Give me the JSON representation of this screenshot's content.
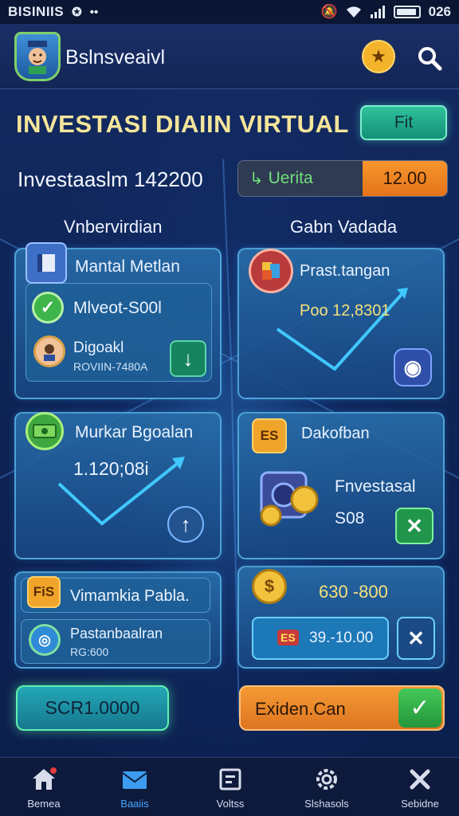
{
  "status_bar": {
    "carrier": "BISINIIS",
    "time": "026"
  },
  "header": {
    "app_title": "Bslnsveaivl"
  },
  "headline": "INVESTASI DIAIIN VIRTUAL",
  "fit_button": "Fit",
  "investment": {
    "label": "Investaaslm 142200",
    "pill_left": "Uerita",
    "pill_right": "12.00"
  },
  "columns": {
    "left": "Vnbervirdian",
    "right": "Gabn Vadada"
  },
  "cards": {
    "mantal": {
      "title": "Mantal Metlan",
      "row1": "Mlveot-S00l",
      "row2_title": "Digoakl",
      "row2_sub": "ROVIIN-7480A"
    },
    "prast": {
      "title": "Prast.tangan",
      "value": "Poo 12,8301"
    },
    "murkar": {
      "title": "Murkar Bgoalan",
      "value": "1.120;08i"
    },
    "dakof": {
      "title": "Dakofban",
      "badge": "ES",
      "line1": "Fnvestasal",
      "line2": "S08"
    },
    "vimamkia": {
      "badge": "FiS",
      "title": "Vimamkia Pabla.",
      "sub_title": "Pastanbaalran",
      "sub_value": "RG:600"
    },
    "coin": {
      "value": "630 -800",
      "field_value": "39.-10.00",
      "field_tag": "ES"
    }
  },
  "buttons": {
    "score": "SCR1.0000",
    "exiden": "Exiden.Can"
  },
  "nav": [
    {
      "label": "Bemea",
      "icon": "home-icon"
    },
    {
      "label": "Baaiis",
      "icon": "envelope-icon"
    },
    {
      "label": "Voltss",
      "icon": "ledger-icon"
    },
    {
      "label": "Slshasols",
      "icon": "gear-icon"
    },
    {
      "label": "Sebidne",
      "icon": "tools-icon"
    }
  ],
  "colors": {
    "accent_gold": "#f5e59a",
    "accent_green": "#30c29c",
    "accent_orange": "#f7952c",
    "nav_active": "#4aa8ff"
  }
}
